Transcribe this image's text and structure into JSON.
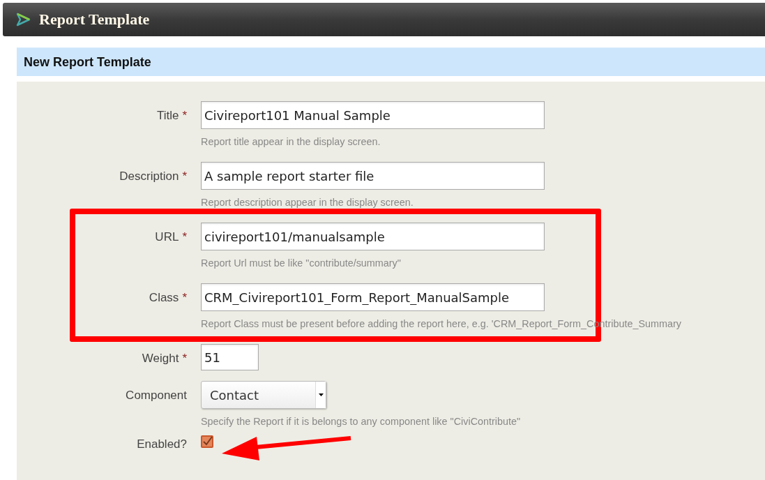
{
  "header": {
    "title": "Report Template"
  },
  "section": {
    "title": "New Report Template"
  },
  "fields": [
    {
      "kind": "text",
      "label": "Title",
      "required_mark": "*",
      "value": "Civireport101 Manual Sample",
      "hint": "Report title appear in the display screen."
    },
    {
      "kind": "text",
      "label": "Description",
      "required_mark": "*",
      "value": "A sample report starter file",
      "hint": "Report description appear in the display screen."
    },
    {
      "kind": "text",
      "label": "URL",
      "required_mark": "*",
      "value": "civireport101/manualsample",
      "hint": "Report Url must be like \"contribute/summary\""
    },
    {
      "kind": "text",
      "label": "Class",
      "required_mark": "*",
      "value": "CRM_Civireport101_Form_Report_ManualSample",
      "hint": "Report Class must be present before adding the report here, e.g. 'CRM_Report_Form_Contribute_Summary"
    },
    {
      "kind": "number",
      "label": "Weight",
      "required_mark": "*",
      "value": "51"
    },
    {
      "kind": "select",
      "label": "Component",
      "value": "Contact",
      "hint": "Specify the Report if it is belongs to any component like \"CiviContribute\""
    },
    {
      "kind": "checkbox",
      "label": "Enabled?",
      "checked": true
    }
  ]
}
